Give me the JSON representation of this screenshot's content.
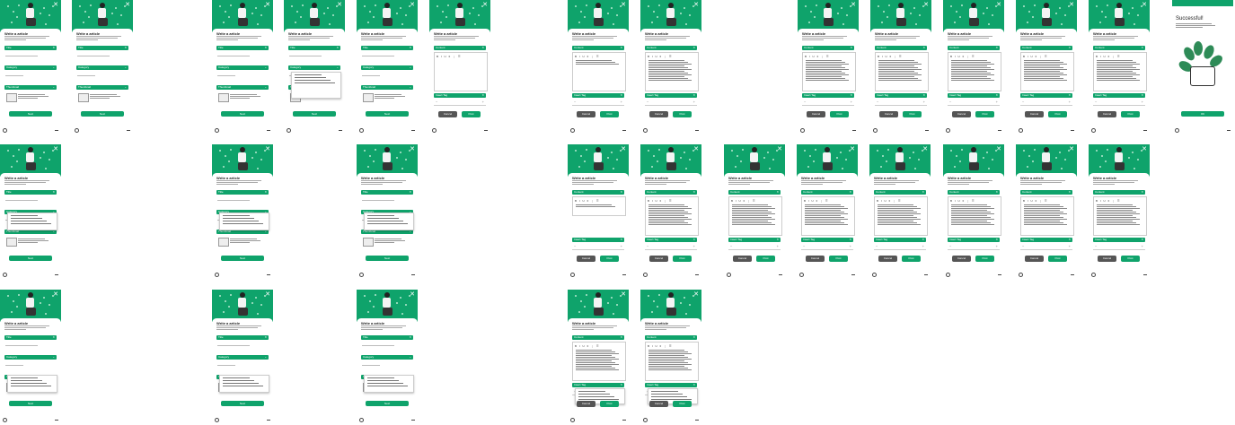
{
  "common": {
    "accent": "#0fa36b",
    "close_icon": "close-icon",
    "home_icon": "home-icon",
    "title": "Write a article",
    "field_title": "Title",
    "field_category": "Category",
    "field_thumbnail": "Thumbnail",
    "field_content": "Content",
    "field_tags": "Insert Tag",
    "button_next": "Next",
    "button_cancel": "Cancel",
    "button_post": "Post",
    "button_continue": "Continue",
    "toolbar": "B I U ≡ ⋮ ☰"
  },
  "success": {
    "title": "Successful!",
    "button": "OK"
  }
}
